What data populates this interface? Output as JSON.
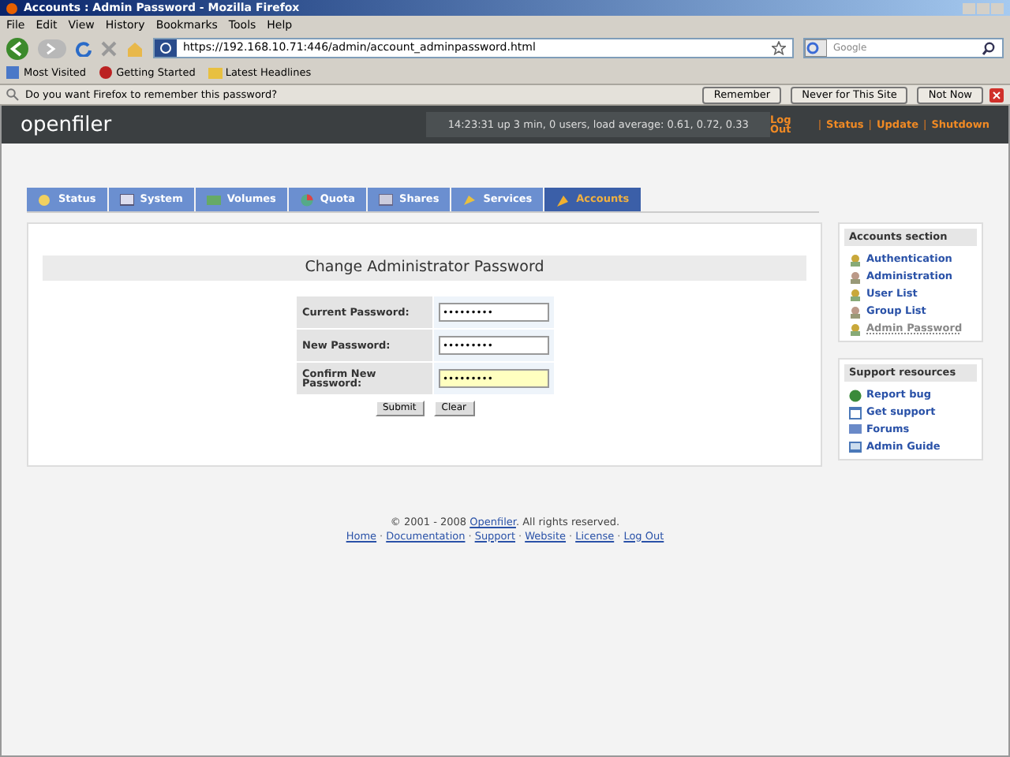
{
  "window": {
    "title": "Accounts : Admin Password - Mozilla Firefox"
  },
  "menu": [
    "File",
    "Edit",
    "View",
    "History",
    "Bookmarks",
    "Tools",
    "Help"
  ],
  "address": {
    "url": "https://192.168.10.71:446/admin/account_adminpassword.html"
  },
  "search": {
    "placeholder": "Google"
  },
  "bookmarks": [
    "Most Visited",
    "Getting Started",
    "Latest Headlines"
  ],
  "password_bar": {
    "message": "Do you want Firefox to remember this password?",
    "buttons": [
      "Remember",
      "Never for This Site",
      "Not Now"
    ]
  },
  "header": {
    "logo": "openfiler",
    "status": "14:23:31 up 3 min, 0 users, load average: 0.61, 0.72, 0.33",
    "links": [
      "Log Out",
      "Status",
      "Update",
      "Shutdown"
    ],
    "separator": "|"
  },
  "tabs": [
    {
      "label": "Status",
      "selected": false
    },
    {
      "label": "System",
      "selected": false
    },
    {
      "label": "Volumes",
      "selected": false
    },
    {
      "label": "Quota",
      "selected": false
    },
    {
      "label": "Shares",
      "selected": false
    },
    {
      "label": "Services",
      "selected": false
    },
    {
      "label": "Accounts",
      "selected": true
    }
  ],
  "form": {
    "title": "Change Administrator Password",
    "fields": [
      {
        "label": "Current Password:",
        "value": "•••••••••",
        "focused": false
      },
      {
        "label": "New Password:",
        "value": "•••••••••",
        "focused": false
      },
      {
        "label": "Confirm New Password:",
        "value": "•••••••••",
        "focused": true
      }
    ],
    "buttons": [
      "Submit",
      "Clear"
    ]
  },
  "sidebar": [
    {
      "title": "Accounts section",
      "items": [
        {
          "label": "Authentication",
          "selected": false
        },
        {
          "label": "Administration",
          "selected": false
        },
        {
          "label": "User List",
          "selected": false
        },
        {
          "label": "Group List",
          "selected": false
        },
        {
          "label": "Admin Password",
          "selected": true
        }
      ]
    },
    {
      "title": "Support resources",
      "items": [
        {
          "label": "Report bug",
          "selected": false
        },
        {
          "label": "Get support",
          "selected": false
        },
        {
          "label": "Forums",
          "selected": false
        },
        {
          "label": "Admin Guide",
          "selected": false
        }
      ]
    }
  ],
  "footer": {
    "copyright": {
      "before": "© 2001 - 2008 ",
      "link": "Openfiler",
      "after": ". All rights reserved."
    },
    "links": [
      "Home",
      "Documentation",
      "Support",
      "Website",
      "License",
      "Log Out"
    ],
    "separator": "·"
  }
}
